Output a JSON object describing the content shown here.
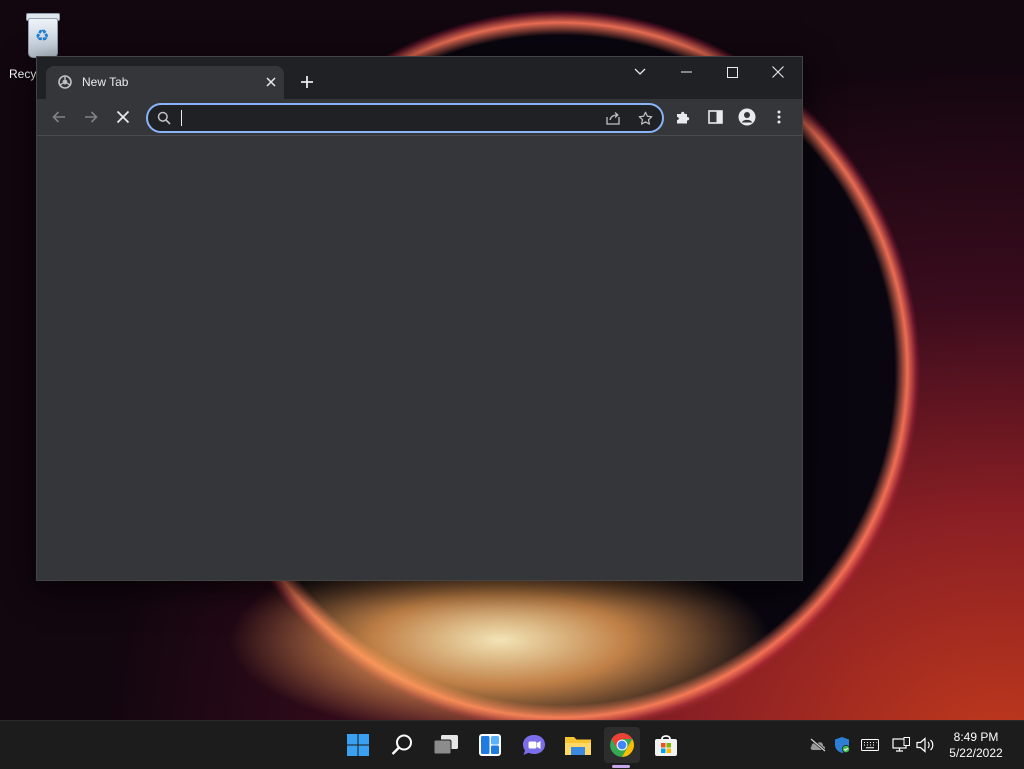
{
  "desktop": {
    "icons": [
      {
        "label": "Recycle Bin",
        "icon": "recycle-bin-icon"
      }
    ]
  },
  "browser": {
    "tabs": [
      {
        "title": "New Tab",
        "icon": "chrome-newtab-icon"
      }
    ],
    "new_tab_icon": "plus-icon",
    "caption_buttons": [
      "tab-search-icon",
      "minimize-icon",
      "maximize-icon",
      "close-icon"
    ],
    "toolbar": {
      "back_icon": "back-arrow-icon",
      "forward_icon": "forward-arrow-icon",
      "stop_icon": "stop-loading-icon",
      "extensions_icon": "puzzle-icon",
      "side_panel_icon": "side-panel-icon",
      "profile_icon": "profile-icon",
      "menu_icon": "kebab-menu-icon"
    },
    "omnibox": {
      "value": "",
      "placeholder": "",
      "share_icon": "share-icon",
      "bookmark_icon": "star-icon"
    },
    "colors": {
      "frame": "#202124",
      "tab": "#35363a",
      "focus": "#8ab4f8"
    }
  },
  "taskbar": {
    "apps": [
      {
        "name": "Start",
        "icon": "windows-start-icon"
      },
      {
        "name": "Search",
        "icon": "search-icon"
      },
      {
        "name": "Task View",
        "icon": "task-view-icon"
      },
      {
        "name": "Widgets",
        "icon": "widgets-icon"
      },
      {
        "name": "Chat",
        "icon": "teams-chat-icon"
      },
      {
        "name": "File Explorer",
        "icon": "folder-icon"
      },
      {
        "name": "Google Chrome",
        "icon": "chrome-icon",
        "active": true
      },
      {
        "name": "Microsoft Store",
        "icon": "store-icon"
      }
    ],
    "tray": [
      "onedrive-offline-icon",
      "windows-security-icon",
      "keyboard-icon",
      "network-icon",
      "volume-icon"
    ],
    "clock": {
      "time": "8:49 PM",
      "date": "5/22/2022"
    }
  }
}
